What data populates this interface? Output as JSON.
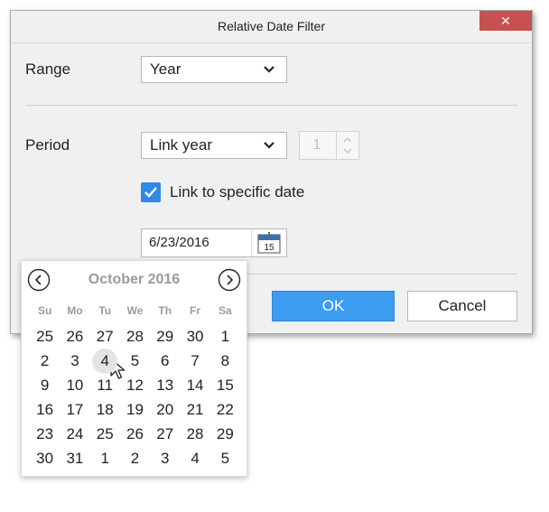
{
  "dialog": {
    "title": "Relative Date Filter",
    "close_glyph": "✕",
    "range_label": "Range",
    "range_value": "Year",
    "period_label": "Period",
    "period_value": "Link year",
    "period_count": "1",
    "link_checkbox_checked": true,
    "link_label": "Link to specific date",
    "date_value": "6/23/2016",
    "calendar_icon_day": "15",
    "ok_label": "OK",
    "cancel_label": "Cancel"
  },
  "calendar": {
    "month_title": "October 2016",
    "weekdays": [
      "Su",
      "Mo",
      "Tu",
      "We",
      "Th",
      "Fr",
      "Sa"
    ],
    "weeks": [
      [
        "25",
        "26",
        "27",
        "28",
        "29",
        "30",
        "1"
      ],
      [
        "2",
        "3",
        "4",
        "5",
        "6",
        "7",
        "8"
      ],
      [
        "9",
        "10",
        "11",
        "12",
        "13",
        "14",
        "15"
      ],
      [
        "16",
        "17",
        "18",
        "19",
        "20",
        "21",
        "22"
      ],
      [
        "23",
        "24",
        "25",
        "26",
        "27",
        "28",
        "29"
      ],
      [
        "30",
        "31",
        "1",
        "2",
        "3",
        "4",
        "5"
      ]
    ],
    "hovered_day": "4"
  },
  "colors": {
    "accent": "#3b9cf0",
    "checkbox": "#2d8be6",
    "close": "#c75050"
  }
}
